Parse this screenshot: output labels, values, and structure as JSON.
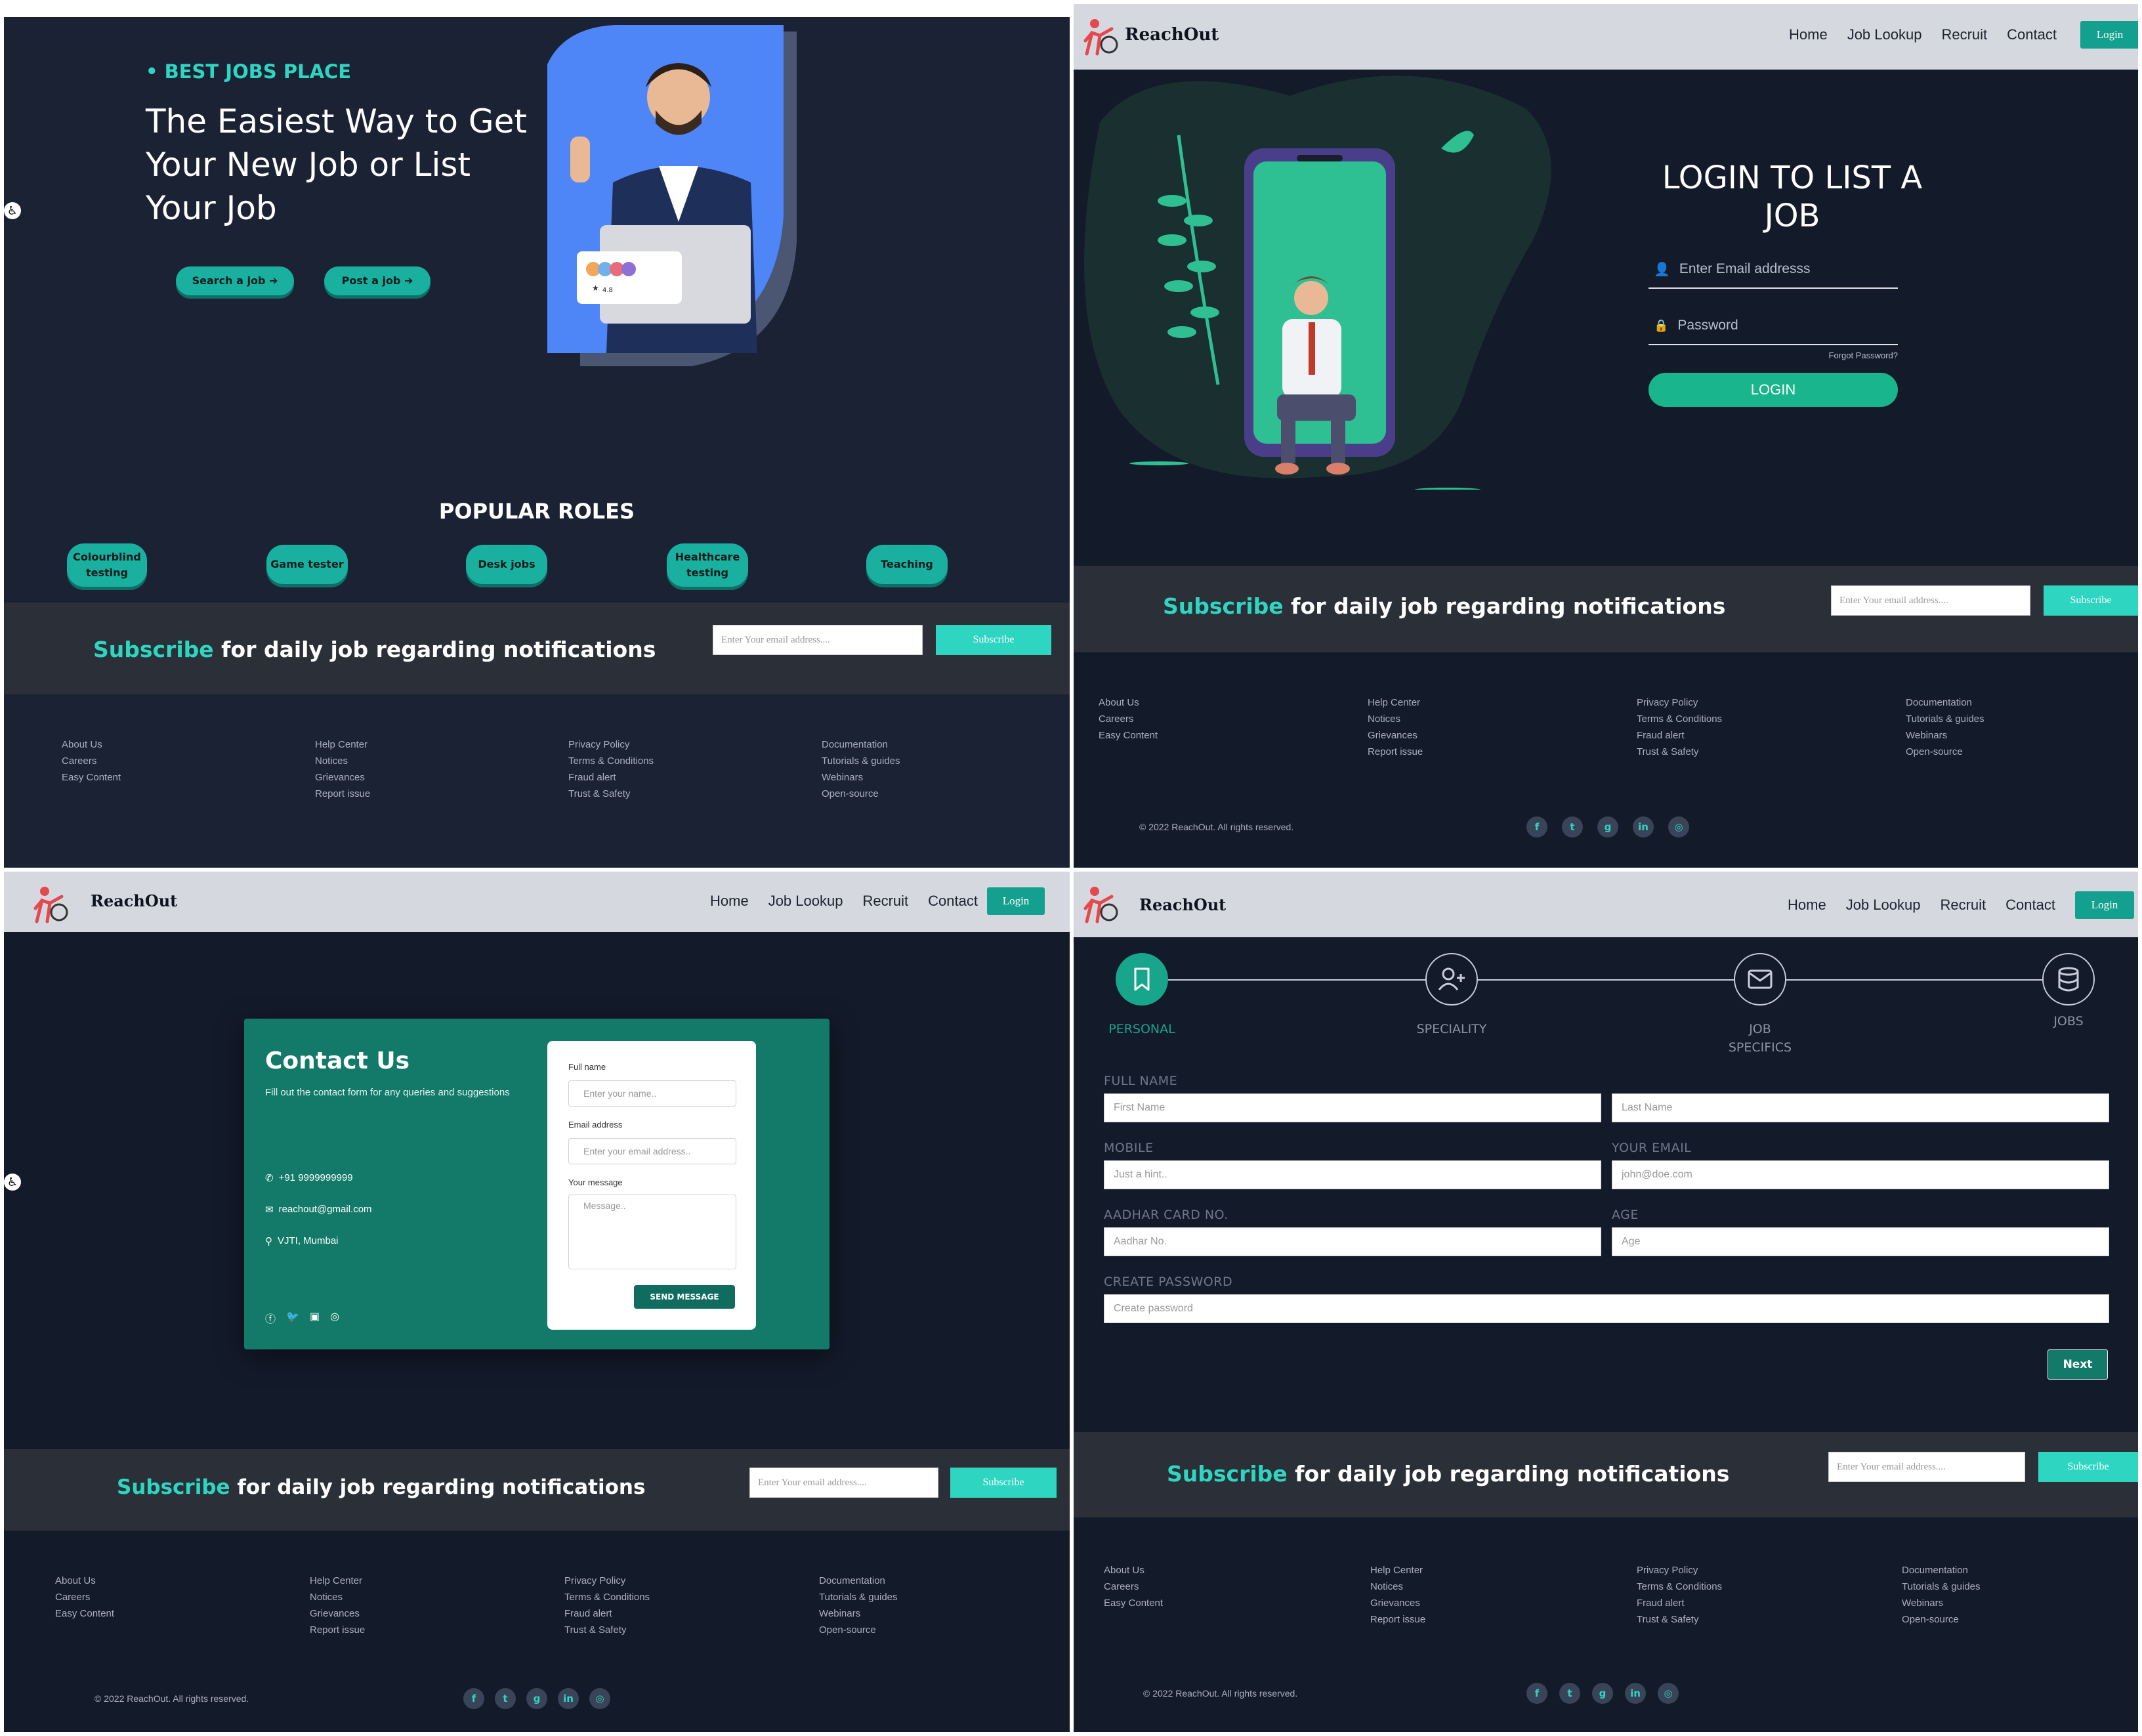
{
  "colors": {
    "accent": "#2ed6c1",
    "accent_dark": "#14a08e",
    "bg_dark": "#131a2a",
    "navbar": "#d5d8df",
    "band": "#2b2f38"
  },
  "common": {
    "brand": "ReachOut",
    "nav": [
      "Home",
      "Job Lookup",
      "Recruit",
      "Contact"
    ],
    "login_button": "Login",
    "subscribe": {
      "highlight": "Subscribe",
      "text": " for daily job regarding notifications",
      "placeholder": "Enter Your email address....",
      "button": "Subscribe"
    },
    "footer": {
      "col1": [
        "About Us",
        "Careers",
        "Easy Content"
      ],
      "col2": [
        "Help Center",
        "Notices",
        "Grievances",
        "Report issue"
      ],
      "col3": [
        "Privacy Policy",
        "Terms & Conditions",
        "Fraud alert",
        "Trust & Safety"
      ],
      "col4": [
        "Documentation",
        "Tutorials & guides",
        "Webinars",
        "Open-source"
      ]
    },
    "copyright": "© 2022 ReachOut. All rights reserved.",
    "social_icons": [
      "facebook-icon",
      "twitter-icon",
      "github-icon",
      "linkedin-icon",
      "instagram-icon"
    ]
  },
  "home": {
    "eyebrow": "• BEST JOBS PLACE",
    "headline_1": "The Easiest Way to Get",
    "headline_2": "Your New Job or List",
    "headline_3": "Your Job",
    "search_button": "Search a job ➔",
    "post_button": "Post a job ➔",
    "popular_title": "POPULAR ROLES",
    "roles": [
      "Colourblind testing",
      "Game tester",
      "Desk jobs",
      "Healthcare testing",
      "Teaching"
    ],
    "rating": "4.8"
  },
  "login": {
    "title_1": "LOGIN TO LIST A",
    "title_2": "JOB",
    "email_placeholder": "Enter Email addresss",
    "password_placeholder": "Password",
    "forgot": "Forgot Password?",
    "button": "LOGIN"
  },
  "contact": {
    "title": "Contact Us",
    "subtitle": "Fill out the contact form for any queries and suggestions",
    "phone": "+91 9999999999",
    "email": "reachout@gmail.com",
    "address": "VJTI, Mumbai",
    "full_name_label": "Full name",
    "full_name_placeholder": "Enter your name..",
    "email_label": "Email address",
    "email_placeholder": "Enter your email address..",
    "message_label": "Your message",
    "message_placeholder": "Message..",
    "send_button": "SEND MESSAGE"
  },
  "register": {
    "steps": [
      "PERSONAL",
      "SPECIALITY",
      "JOB SPECIFICS",
      "JOBS"
    ],
    "step_2_line1": "JOB",
    "step_2_line2": "SPECIFICS",
    "full_name_label": "FULL NAME",
    "first_name": "First Name",
    "last_name": "Last Name",
    "mobile_label": "MOBILE",
    "mobile_placeholder": "Just a hint..",
    "email_label": "YOUR EMAIL",
    "email_placeholder": "john@doe.com",
    "aadhar_label": "AADHAR CARD NO.",
    "aadhar_placeholder": "Aadhar No.",
    "age_label": "AGE",
    "age_placeholder": "Age",
    "password_label": "CREATE PASSWORD",
    "password_placeholder": "Create password",
    "next_button": "Next"
  }
}
